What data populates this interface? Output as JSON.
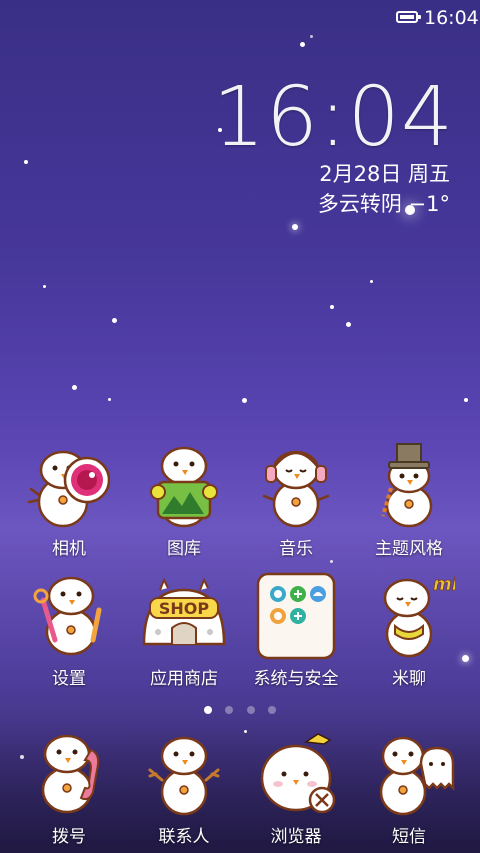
{
  "status_bar": {
    "time": "16:04",
    "battery_icon": "battery-full-icon"
  },
  "lock_clock": {
    "time": "16:04",
    "date": "2月28日 周五",
    "weather": "多云转阴  −1°"
  },
  "apps": [
    {
      "label": "相机",
      "icon": "camera-snowman-icon"
    },
    {
      "label": "图库",
      "icon": "gallery-snowman-icon"
    },
    {
      "label": "音乐",
      "icon": "music-snowman-icon"
    },
    {
      "label": "主题风格",
      "icon": "theme-snowman-icon"
    },
    {
      "label": "设置",
      "icon": "settings-snowman-icon"
    },
    {
      "label": "应用商店",
      "icon": "shop-snowman-icon"
    },
    {
      "label": "系统与安全",
      "icon": "system-security-folder-icon"
    },
    {
      "label": "米聊",
      "icon": "miliao-snowman-icon",
      "badge": "mi"
    }
  ],
  "shop_sign": "SHOP",
  "page_indicator": {
    "count": 4,
    "active": 0
  },
  "dock": [
    {
      "label": "拨号",
      "icon": "dialer-snowman-icon"
    },
    {
      "label": "联系人",
      "icon": "contacts-snowman-icon"
    },
    {
      "label": "浏览器",
      "icon": "browser-snowman-icon"
    },
    {
      "label": "短信",
      "icon": "sms-snowman-icon"
    }
  ]
}
